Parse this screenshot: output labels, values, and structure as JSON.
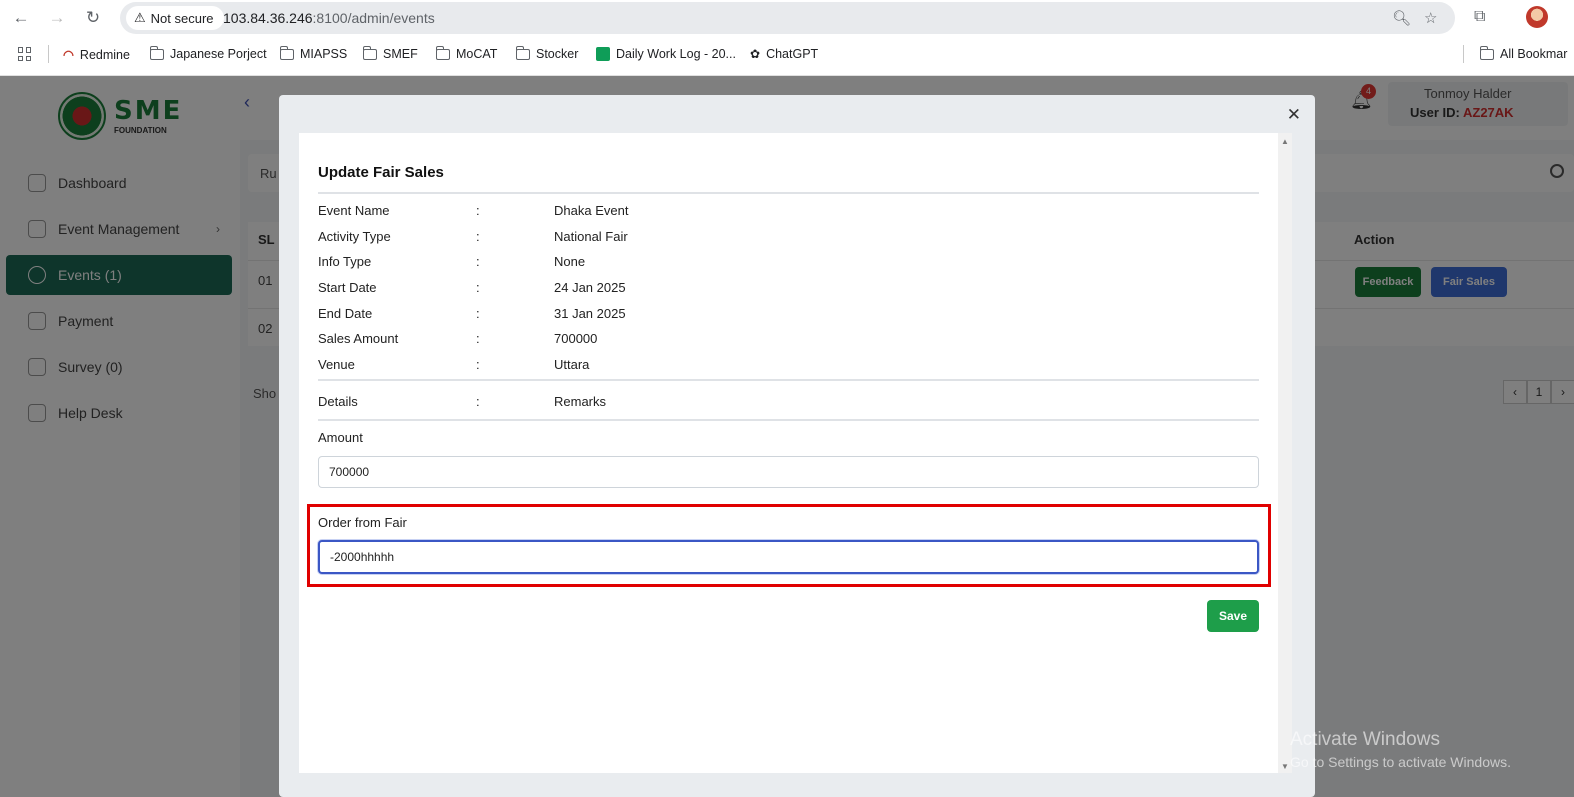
{
  "browser": {
    "security_label": "Not secure",
    "url_host": "103.84.36.246",
    "url_rest": ":8100/admin/events",
    "bookmarks": [
      "Redmine",
      "Japanese Porject",
      "MIAPSS",
      "SMEF",
      "MoCAT",
      "Stocker",
      "Daily Work Log - 20...",
      "ChatGPT"
    ],
    "all_bookmarks": "All Bookmar"
  },
  "app": {
    "logo_text": "SME",
    "logo_sub": "FOUNDATION",
    "sidebar": [
      "Dashboard",
      "Event Management",
      "Events (1)",
      "Payment",
      "Survey (0)",
      "Help Desk"
    ],
    "notifications": "4",
    "user_name": "Tonmoy Halder",
    "user_id_label": "User ID: ",
    "user_id": "AZ27AK",
    "filter_label": "Ru",
    "table_headers": {
      "sl": "SL",
      "action": "Action"
    },
    "rows": [
      "01",
      "02"
    ],
    "feedback_btn": "Feedback",
    "fair_sales_btn": "Fair Sales",
    "show_label": "Sho",
    "page": "1"
  },
  "modal": {
    "title": "Update Fair Sales",
    "colon": ":",
    "info": [
      {
        "key": "Event Name",
        "value": "Dhaka Event"
      },
      {
        "key": "Activity Type",
        "value": "National Fair"
      },
      {
        "key": "Info Type",
        "value": "None"
      },
      {
        "key": "Start Date",
        "value": "24 Jan 2025"
      },
      {
        "key": "End Date",
        "value": "31 Jan 2025"
      },
      {
        "key": "Sales Amount",
        "value": "700000"
      },
      {
        "key": "Venue",
        "value": "Uttara"
      }
    ],
    "details": {
      "key": "Details",
      "value": "Remarks"
    },
    "amount_label": "Amount",
    "amount_value": "700000",
    "order_label": "Order from Fair",
    "order_value": "-2000hhhhh",
    "save_label": "Save"
  },
  "watermark": {
    "line1": "Activate Windows",
    "line2": "Go to Settings to activate Windows."
  }
}
